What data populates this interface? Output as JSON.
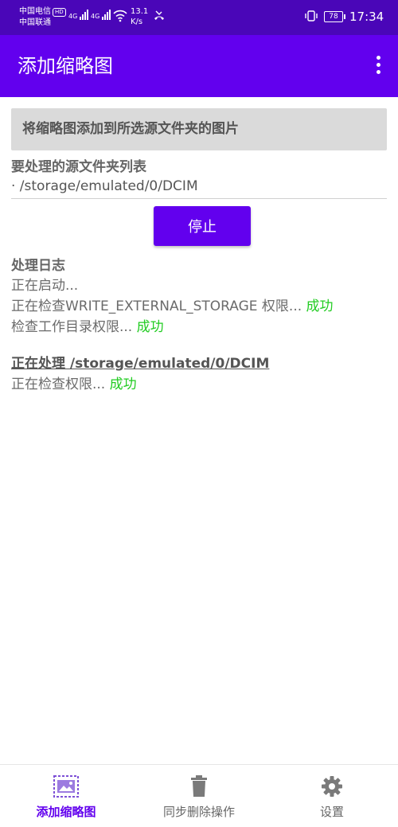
{
  "status_bar": {
    "carrier_1": "中国电信",
    "hd_badge": "HD",
    "carrier_2": "中国联通",
    "network_1": "4G",
    "network_2": "4G",
    "speed_value": "13.1",
    "speed_unit": "K/s",
    "battery": "78",
    "time": "17:34"
  },
  "app_bar": {
    "title": "添加缩略图",
    "menu_icon": "more-vert-icon"
  },
  "main": {
    "info_text": "将缩略图添加到所选源文件夹的图片",
    "folders_title": "要处理的源文件夹列表",
    "folders": [
      "· /storage/emulated/0/DCIM"
    ],
    "stop_button": "停止",
    "log_title": "处理日志",
    "log": {
      "line1": "正在启动...",
      "line2_text": "正在检查WRITE_EXTERNAL_STORAGE 权限... ",
      "line2_status": "成功",
      "line3_text": "检查工作目录权限... ",
      "line3_status": "成功",
      "processing_heading": "正在处理 /storage/emulated/0/DCIM",
      "line4_text": "正在检查权限... ",
      "line4_status": "成功"
    },
    "colors": {
      "accent": "#6200ee",
      "success": "#22cc22",
      "status_bar": "#4a06b8"
    }
  },
  "bottom_nav": {
    "items": [
      {
        "label": "添加缩略图",
        "icon": "image-add-icon",
        "active": true
      },
      {
        "label": "同步删除操作",
        "icon": "trash-icon",
        "active": false
      },
      {
        "label": "设置",
        "icon": "gear-icon",
        "active": false
      }
    ]
  }
}
